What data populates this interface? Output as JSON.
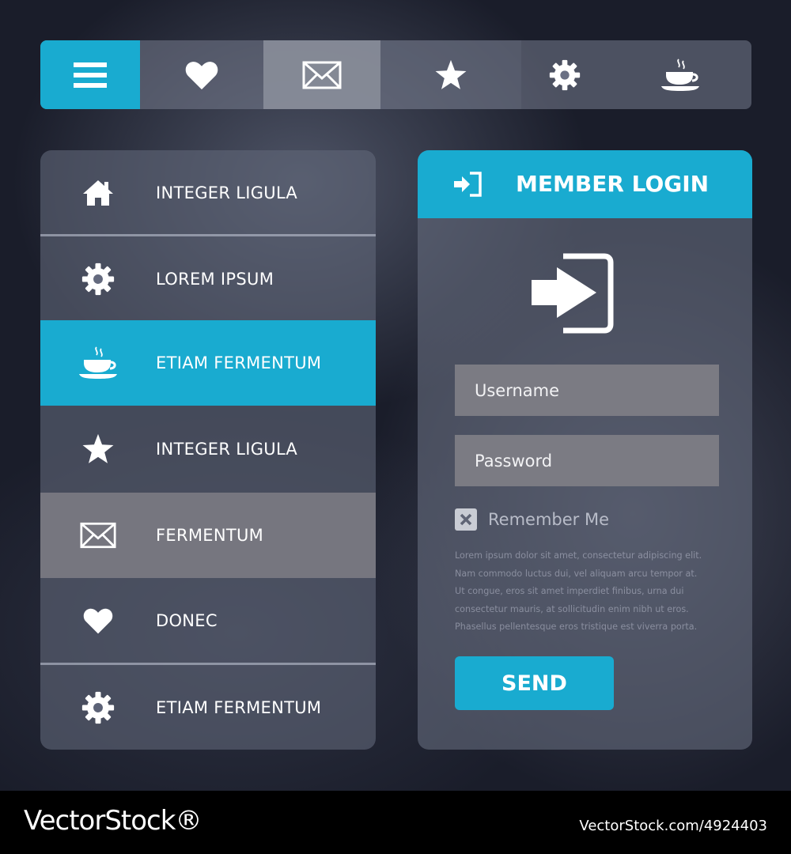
{
  "colors": {
    "accent": "#19abd0",
    "panel": "#60667a",
    "highlight": "#76767f",
    "background": "#1a1d2a"
  },
  "topbar": {
    "items": [
      {
        "icon": "menu-icon",
        "state": "active"
      },
      {
        "icon": "heart-icon",
        "state": "normal"
      },
      {
        "icon": "mail-icon",
        "state": "highlight"
      },
      {
        "icon": "star-icon",
        "state": "normal"
      },
      {
        "icon": "gear-icon",
        "state": "normal"
      },
      {
        "icon": "coffee-cup-icon",
        "state": "normal"
      }
    ]
  },
  "sidebar": {
    "items": [
      {
        "icon": "home-icon",
        "label": "INTEGER LIGULA"
      },
      {
        "icon": "gear-icon",
        "label": "LOREM IPSUM"
      },
      {
        "icon": "coffee-cup-icon",
        "label": "ETIAM FERMENTUM",
        "state": "active"
      },
      {
        "icon": "star-icon",
        "label": "INTEGER LIGULA"
      },
      {
        "icon": "mail-icon",
        "label": "FERMENTUM",
        "state": "highlight"
      },
      {
        "icon": "heart-icon",
        "label": "DONEC"
      },
      {
        "icon": "gear-icon",
        "label": "ETIAM FERMENTUM"
      }
    ]
  },
  "login": {
    "title": "MEMBER LOGIN",
    "header_icon": "sign-in-icon",
    "big_icon": "sign-in-icon",
    "username_placeholder": "Username",
    "password_placeholder": "Password",
    "remember_label": "Remember Me",
    "remember_checked": true,
    "description_lines": [
      "Lorem ipsum dolor sit amet, consectetur adipiscing elit.",
      "Nam commodo luctus dui, vel aliquam arcu tempor at.",
      "Ut congue, eros sit amet imperdiet finibus, urna dui",
      "consectetur mauris, at sollicitudin enim nibh ut eros.",
      "Phasellus pellentesque eros tristique est viverra porta."
    ],
    "send_label": "SEND"
  },
  "watermark": {
    "logo": "VectorStock®",
    "id": "VectorStock.com/4924403"
  }
}
